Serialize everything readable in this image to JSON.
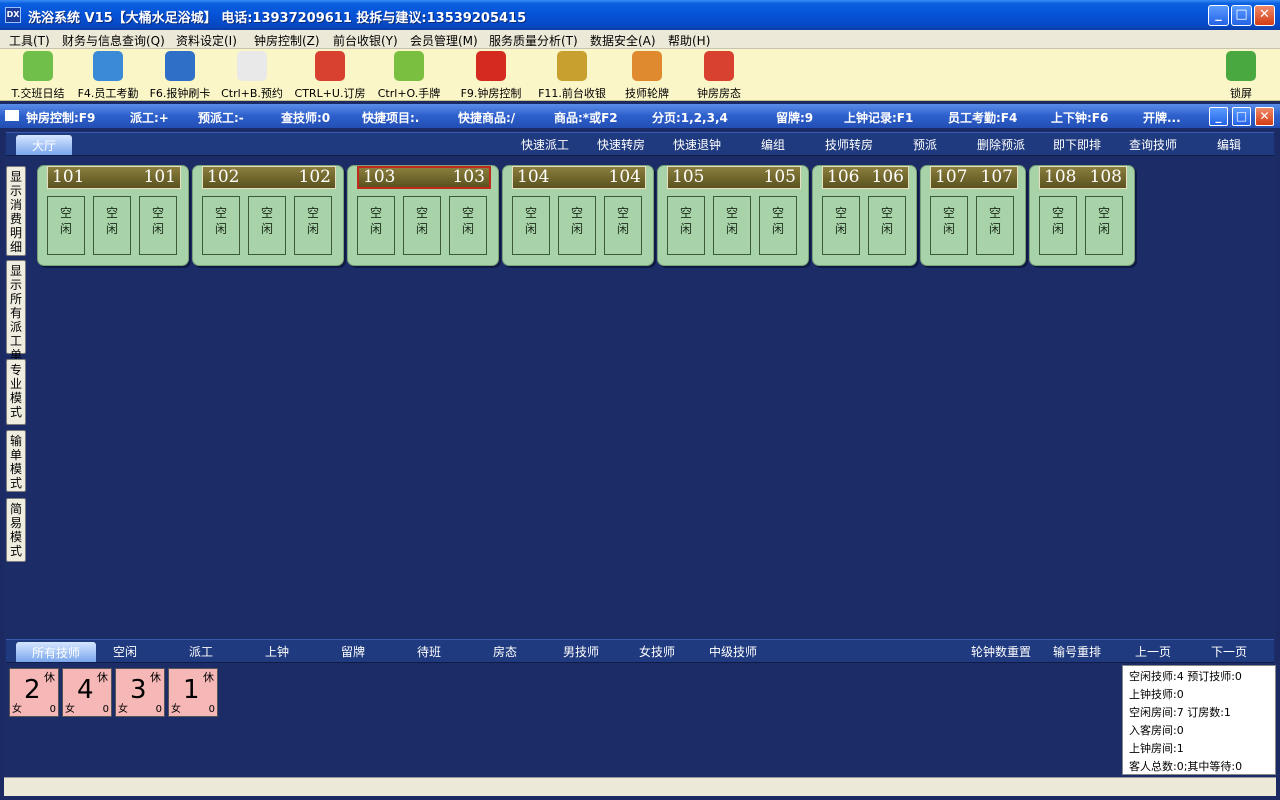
{
  "window": {
    "icon_text": "DX",
    "title": "洗浴系统 V15【大桶水足浴城】 电话:13937209611 投拆与建议:13539205415"
  },
  "menu": [
    {
      "label": "工具(T)"
    },
    {
      "label": "财务与信息查询(Q)"
    },
    {
      "label": "资料设定(I)"
    },
    {
      "label": "钟房控制(Z)"
    },
    {
      "label": "前台收银(Y)"
    },
    {
      "label": "会员管理(M)"
    },
    {
      "label": "服务质量分析(T)"
    },
    {
      "label": "数据安全(A)"
    },
    {
      "label": "帮助(H)"
    }
  ],
  "toolbar": [
    {
      "label": "T.交班日结",
      "icon": "ledger-icon",
      "color": "#6fbf4a"
    },
    {
      "label": "F4.员工考勤",
      "icon": "staff-icon",
      "color": "#3a8ad8"
    },
    {
      "label": "F6.报钟刷卡",
      "icon": "person-card-icon",
      "color": "#2f6fc8"
    },
    {
      "label": "Ctrl+B.预约",
      "icon": "calendar-icon",
      "color": "#e9e9e9"
    },
    {
      "label": "CTRL+U.订房",
      "icon": "house-search-icon",
      "color": "#d84030"
    },
    {
      "label": "Ctrl+O.手牌",
      "icon": "key-tag-icon",
      "color": "#7bbf40"
    },
    {
      "label": "F9.钟房控制",
      "icon": "stop-hand-icon",
      "color": "#d42a20"
    },
    {
      "label": "F11.前台收银",
      "icon": "cash-register-icon",
      "color": "#c8a030"
    },
    {
      "label": "技师轮牌",
      "icon": "technician-icon",
      "color": "#e08a30"
    },
    {
      "label": "钟房房态",
      "icon": "house-icon",
      "color": "#d84030"
    },
    {
      "label": "锁屏",
      "icon": "lock-icon",
      "color": "#4aa840"
    }
  ],
  "inner_window": {
    "items": [
      "钟房控制:F9",
      "派工:+",
      "预派工:-",
      "查技师:0",
      "快捷项目:.",
      "快捷商品:/",
      "商品:*或F2",
      "分页:1,2,3,4",
      "留牌:9",
      "上钟记录:F1",
      "员工考勤:F4",
      "上下钟:F6",
      "开牌..."
    ]
  },
  "top_tabs": {
    "active": "大厅",
    "actions": [
      "快速派工",
      "快速转房",
      "快速退钟",
      "编组",
      "技师转房",
      "预派",
      "删除预派",
      "即下即排",
      "查询技师",
      "编辑"
    ]
  },
  "side_buttons": [
    "显示消费明细",
    "显示所有派工单",
    "专业模式",
    "输单模式",
    "简易模式"
  ],
  "rooms": [
    {
      "left": "101",
      "right": "101",
      "beds": [
        "空闲",
        "空闲",
        "空闲"
      ],
      "selected": false
    },
    {
      "left": "102",
      "right": "102",
      "beds": [
        "空闲",
        "空闲",
        "空闲"
      ],
      "selected": false
    },
    {
      "left": "103",
      "right": "103",
      "beds": [
        "空闲",
        "空闲",
        "空闲"
      ],
      "selected": true
    },
    {
      "left": "104",
      "right": "104",
      "beds": [
        "空闲",
        "空闲",
        "空闲"
      ],
      "selected": false
    },
    {
      "left": "105",
      "right": "105",
      "beds": [
        "空闲",
        "空闲",
        "空闲"
      ],
      "selected": false
    },
    {
      "left": "106",
      "right": "106",
      "beds": [
        "空闲",
        "空闲"
      ],
      "selected": false
    },
    {
      "left": "107",
      "right": "107",
      "beds": [
        "空闲",
        "空闲"
      ],
      "selected": false
    },
    {
      "left": "108",
      "right": "108",
      "beds": [
        "空闲",
        "空闲"
      ],
      "selected": false
    }
  ],
  "bottom_tabs": {
    "active": "所有技师",
    "items": [
      "空闲",
      "派工",
      "上钟",
      "留牌",
      "待班",
      "房态",
      "男技师",
      "女技师",
      "中级技师"
    ],
    "actions": [
      "轮钟数重置",
      "输号重排",
      "上一页",
      "下一页"
    ]
  },
  "technicians": [
    {
      "number": "2",
      "corner": "休",
      "gender": "女",
      "count": "0"
    },
    {
      "number": "4",
      "corner": "休",
      "gender": "女",
      "count": "0"
    },
    {
      "number": "3",
      "corner": "休",
      "gender": "女",
      "count": "0"
    },
    {
      "number": "1",
      "corner": "休",
      "gender": "女",
      "count": "0"
    }
  ],
  "stats": [
    "空闲技师:4 预订技师:0",
    "上钟技师:0",
    "空闲房间:7 订房数:1",
    "入客房间:0",
    "上钟房间:1",
    "客人总数:0;其中等待:0"
  ]
}
